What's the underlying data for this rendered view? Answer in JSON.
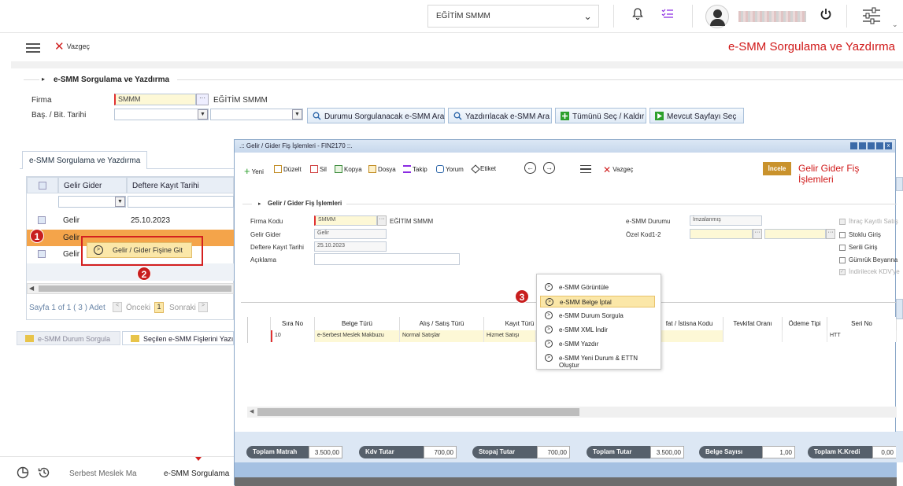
{
  "topbar": {
    "company": "EĞİTİM SMMM"
  },
  "toolbar": {
    "cancel": "Vazgeç",
    "page_title": "e-SMM Sorgulama ve Yazdırma"
  },
  "form": {
    "section_title": "e-SMM Sorgulama ve Yazdırma",
    "firma_label": "Firma",
    "firma_value": "SMMM",
    "firma_name": "EĞİTİM SMMM",
    "date_label": "Baş. / Bit. Tarihi",
    "buttons": [
      "Durumu Sorgulanacak e-SMM Ara",
      "Yazdırılacak e-SMM Ara",
      "Tümünü Seç / Kaldır",
      "Mevcut Sayfayı Seç"
    ]
  },
  "list": {
    "tab": "e-SMM Sorgulama ve Yazdırma",
    "columns": [
      "Gelir Gider",
      "Deftere Kayıt Tarihi"
    ],
    "rows": [
      {
        "type": "Gelir",
        "date": "25.10.2023"
      },
      {
        "type": "Gelir",
        "date": ""
      },
      {
        "type": "Gelir",
        "date": ""
      }
    ],
    "popup": "Gelir / Gider Fişine Git",
    "pager": {
      "summary": "Sayfa 1 of 1 ( 3 ) Adet",
      "prev": "Önceki",
      "page": "1",
      "next": "Sonraki"
    },
    "bottom_tabs": [
      "e-SMM Durum Sorgula",
      "Seçilen e-SMM Fişlerini Yazı"
    ]
  },
  "callouts": [
    "1",
    "2",
    "3"
  ],
  "footer": {
    "tabs": [
      "Serbest Meslek Ma",
      "e-SMM Sorgulama"
    ]
  },
  "modal": {
    "title": ".:: Gelir / Gider Fiş İşlemleri - FIN2170 ::.",
    "toolbar": [
      "Yeni",
      "Düzelt",
      "Sil",
      "Kopya",
      "Dosya",
      "Takip",
      "Yorum",
      "Etiket"
    ],
    "cancel": "Vazgeç",
    "incele": "İncele",
    "header_title": "Gelir Gider Fiş İşlemleri",
    "section": "Gelir / Gider Fiş İşlemleri",
    "fields": {
      "firma_kodu_label": "Firma Kodu",
      "firma_kodu": "SMMM",
      "firma_name": "EĞİTİM SMMM",
      "gelir_gider_label": "Gelir Gider",
      "gelir_gider": "Gelir",
      "tarih_label": "Deftere Kayıt Tarihi",
      "tarih": "25.10.2023",
      "aciklama_label": "Açıklama",
      "durum_label": "e-SMM Durumu",
      "durum": "İmzalanmış",
      "ozel_label": "Özel Kod1-2"
    },
    "checks": [
      "İhraç Kayıtlı Satış",
      "Stoklu Giriş",
      "Serili Giriş",
      "Gümrük Beyanna",
      "İndirilecek KDV'ye"
    ],
    "context_menu": [
      "e-SMM Görüntüle",
      "e-SMM Belge İptal",
      "e-SMM Durum Sorgula",
      "e-SMM XML İndir",
      "e-SMM Yazdır",
      "e-SMM Yeni Durum & ETTN Oluştur"
    ],
    "grid": {
      "columns": [
        "Sıra No",
        "Belge Türü",
        "Alış / Satış Türü",
        "Kayıt Türü",
        "fat / İstisna Kodu",
        "Tevkifat Oranı",
        "Ödeme Tipi",
        "Seri No"
      ],
      "row": [
        "10",
        "e-Serbest Meslek Makbuzu",
        "Normal Satışlar",
        "Hizmet Satışı",
        "",
        "",
        "",
        "HTT"
      ]
    },
    "summary": [
      {
        "label": "Toplam Matrah",
        "value": "3.500,00"
      },
      {
        "label": "Kdv Tutar",
        "value": "700,00"
      },
      {
        "label": "Stopaj Tutar",
        "value": "700,00"
      },
      {
        "label": "Toplam Tutar",
        "value": "3.500,00"
      },
      {
        "label": "Belge Sayısı",
        "value": "1,00"
      },
      {
        "label": "Toplam K.Kredi",
        "value": "0,00"
      }
    ]
  }
}
